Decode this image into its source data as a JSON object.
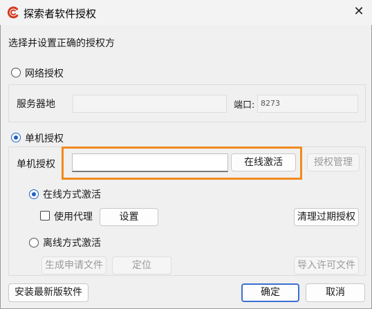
{
  "window": {
    "title": "探索者软件授权",
    "accent": "#d23a1e"
  },
  "instruction": "选择并设置正确的授权方",
  "network": {
    "label": "网络授权",
    "selected": false,
    "server_label": "服务器地",
    "server_value": "",
    "port_label": "端口:",
    "port_value": "8273"
  },
  "standalone": {
    "label": "单机授权",
    "selected": true,
    "key_label": "单机授权",
    "key_value": "",
    "online_activate_button": "在线激活",
    "manage_button": "授权管理",
    "online_mode": {
      "label": "在线方式激活",
      "selected": true
    },
    "proxy": {
      "label": "使用代理",
      "checked": false,
      "settings_button": "设置"
    },
    "clean_expired_button": "清理过期授权",
    "offline_mode": {
      "label": "离线方式激活",
      "selected": false
    },
    "gen_request_button": "生成申请文件",
    "locate_button": "定位",
    "import_license_button": "导入许可文件"
  },
  "footer": {
    "install_button": "安装最新版软件",
    "ok_button": "确定",
    "cancel_button": "取消"
  },
  "highlight_color": "#f08a1c"
}
